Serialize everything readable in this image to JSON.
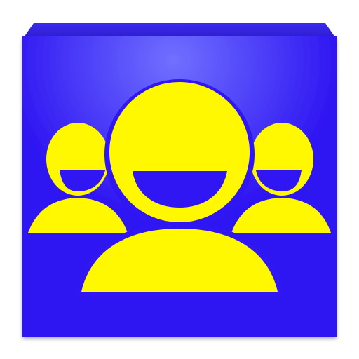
{
  "icon": {
    "name": "group-people-icon",
    "colors": {
      "background": "#2F16F2",
      "background_highlight": "#7070FF",
      "figures": "#FFF800",
      "bevel": "#1E1AA8"
    }
  }
}
